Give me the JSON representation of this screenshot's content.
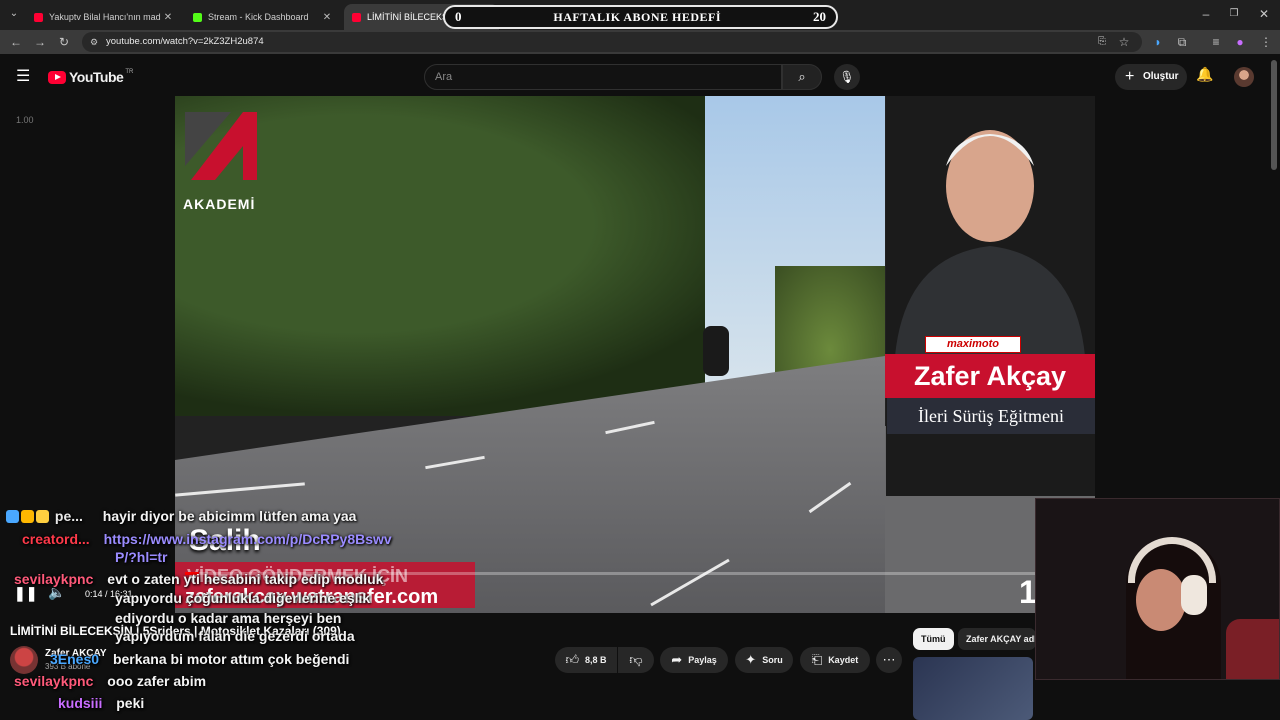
{
  "browser": {
    "tabs": [
      {
        "title": "Yakuptv Bilal Hancı'nın madde",
        "favicon_color": "#ff0033",
        "active": false
      },
      {
        "title": "Stream - Kick Dashboard",
        "favicon_color": "#53fc18",
        "active": false
      },
      {
        "title": "LİMİTİNİ BİLECEKSİN |",
        "favicon_color": "#ff0033",
        "active": true
      }
    ],
    "url": "youtube.com/watch?v=2kZ3ZH2u874"
  },
  "overlay_goal": {
    "current": "0",
    "title": "HAFTALIK ABONE HEDEFİ",
    "target": "20"
  },
  "youtube": {
    "logo_text": "YouTube",
    "region": "TR",
    "search_placeholder": "Ara",
    "create_label": "Oluştur"
  },
  "player": {
    "speed_label": "1.00",
    "time": "0:14 / 16:31",
    "progress_fraction": 0.015,
    "video_overlay": {
      "brand": "AKADEMİ",
      "sponsor": "maximoto",
      "presenter_name": "Zafer Akçay",
      "presenter_role": "İleri Sürüş Eğitmeni",
      "caption_top": "Salih",
      "caption_band": "VİDEO GÖNDERMEK İÇİN",
      "caption_bottom": "zaferakcay.wetransfer.com",
      "corner_number": "1"
    }
  },
  "video_info": {
    "title": "LİMİTİNİ BİLECEKSİN | 5Sriders | Motosiklet Kazaları (309)",
    "channel": "Zafer AKÇAY",
    "subscribers": "393 B abone",
    "likes": "8,8 B",
    "actions": {
      "share": "Paylaş",
      "ask": "Soru",
      "save": "Kaydet"
    }
  },
  "sidebar_chips": {
    "all": "Tümü",
    "channel": "Zafer AKÇAY adl"
  },
  "chat": [
    {
      "user": "pe...",
      "user_color": "#e8e8e8",
      "message": "hayir diyor be abicimm lütfen ama yaa"
    },
    {
      "user": "creatord...",
      "user_color": "#ff3a4a",
      "message": "https://www.instagram.com/p/DcRPy8Bswv",
      "continued": "P/?hl=tr"
    },
    {
      "user": "sevilaykpnc",
      "user_color": "#ff5a7a",
      "message": "evt o zaten yti hesabini takip edip modluk",
      "continued": "yapıyordu çoğunlukla diğerlerine eşlik",
      "continued2": "ediyordu o kadar ama herşeyi ben",
      "continued3": "yapıyordum falan die gezerdi ortada"
    },
    {
      "user": "3Enes0",
      "user_color": "#4aa8ff",
      "message": "berkana bi motor attım çok beğendi"
    },
    {
      "user": "sevilaykpnc",
      "user_color": "#ff5a7a",
      "message": "ooo zafer abim"
    },
    {
      "user": "kudsiii",
      "user_color": "#c86dff",
      "message": "peki"
    }
  ]
}
